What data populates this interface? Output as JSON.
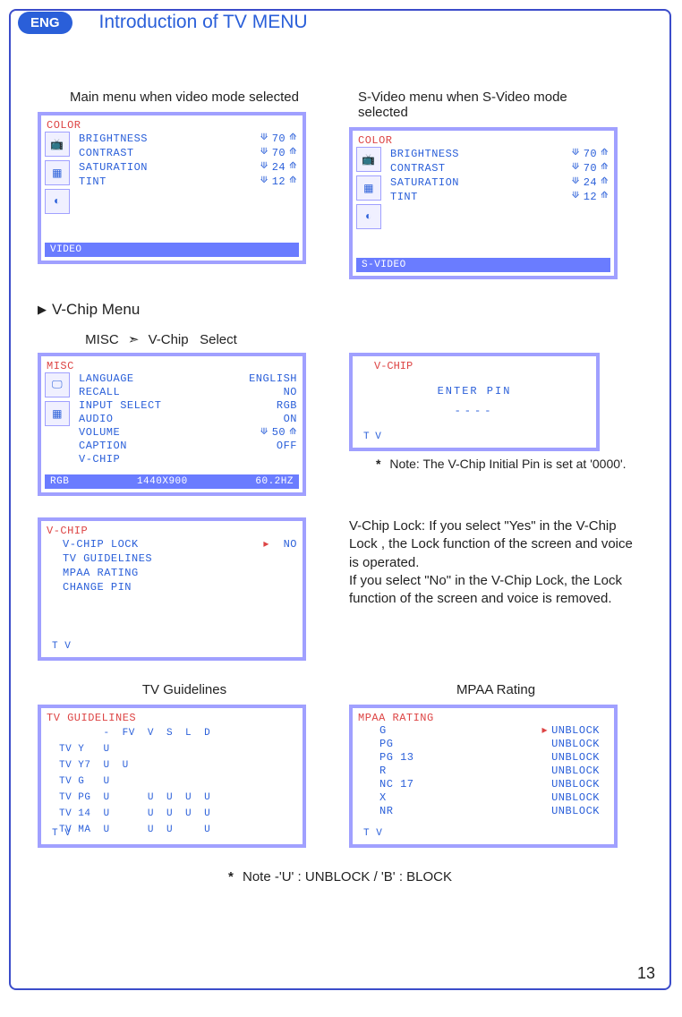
{
  "lang_badge": "ENG",
  "page_title": "Introduction of TV MENU",
  "captions": {
    "main_menu": "Main menu when video mode selected",
    "svideo_menu": "S-Video menu when S-Video mode selected",
    "tv_guidelines": "TV Guidelines",
    "mpaa_rating": "MPAA Rating"
  },
  "section_vchip": "V-Chip Menu",
  "path": {
    "a": "MISC",
    "arrow": "➣",
    "b": "V-Chip",
    "c": "Select"
  },
  "color_menu": {
    "header": "COLOR",
    "items": [
      {
        "label": "BRIGHTNESS",
        "val": "70"
      },
      {
        "label": "CONTRAST",
        "val": "70"
      },
      {
        "label": "SATURATION",
        "val": "24"
      },
      {
        "label": "TINT",
        "val": "12"
      }
    ],
    "footer_video": "VIDEO",
    "footer_svideo": "S-VIDEO"
  },
  "misc_menu": {
    "header": "MISC",
    "items": [
      {
        "label": "LANGUAGE",
        "val": "ENGLISH"
      },
      {
        "label": "RECALL",
        "val": "NO"
      },
      {
        "label": "INPUT SELECT",
        "val": "RGB"
      },
      {
        "label": "AUDIO",
        "val": "ON"
      },
      {
        "label": "VOLUME",
        "val": "50",
        "carets": true
      },
      {
        "label": "CAPTION",
        "val": "OFF"
      },
      {
        "label": "V-CHIP",
        "val": ""
      }
    ],
    "footer_left": "RGB",
    "footer_mid": "1440X900",
    "footer_right": "60.2HZ"
  },
  "vchip_pin": {
    "header": "V-CHIP",
    "enter": "ENTER  PIN",
    "dashes": "----",
    "footer": "T V"
  },
  "vchip_note_star": "*",
  "vchip_note": "Note: The V-Chip Initial Pin is set at '0000'.",
  "vchip_lock_menu": {
    "header": "V-CHIP",
    "items": [
      {
        "label": "V-CHIP  LOCK",
        "val": "NO",
        "mark": true
      },
      {
        "label": "TV  GUIDELINES",
        "val": ""
      },
      {
        "label": "MPAA  RATING",
        "val": ""
      },
      {
        "label": "CHANGE  PIN",
        "val": ""
      }
    ],
    "footer": "T V"
  },
  "vchip_lock_text1": "V-Chip Lock: If you select \"Yes\" in the V-Chip Lock , the Lock function of the screen and voice is operated.",
  "vchip_lock_text2": "If you select \"No\" in the V-Chip Lock, the Lock function of the screen and voice is removed.",
  "tv_guidelines_menu": {
    "header": "TV GUIDELINES",
    "cols": [
      "-",
      "FV",
      "V",
      "S",
      "L",
      "D"
    ],
    "rows": [
      {
        "name": "TV Y",
        "cells": [
          "U",
          "",
          "",
          "",
          "",
          ""
        ]
      },
      {
        "name": "TV Y7",
        "cells": [
          "U",
          "U",
          "",
          "",
          "",
          ""
        ]
      },
      {
        "name": "TV G",
        "cells": [
          "U",
          "",
          "",
          "",
          "",
          ""
        ]
      },
      {
        "name": "TV PG",
        "cells": [
          "U",
          "",
          "U",
          "U",
          "U",
          "U"
        ]
      },
      {
        "name": "TV 14",
        "cells": [
          "U",
          "",
          "U",
          "U",
          "U",
          "U"
        ]
      },
      {
        "name": "TV MA",
        "cells": [
          "U",
          "",
          "U",
          "U",
          "",
          "U"
        ]
      }
    ],
    "footer": "T V"
  },
  "mpaa_menu": {
    "header": "MPAA RATING",
    "items": [
      {
        "label": "G",
        "val": "UNBLOCK",
        "mark": true
      },
      {
        "label": "PG",
        "val": "UNBLOCK"
      },
      {
        "label": "PG 13",
        "val": "UNBLOCK"
      },
      {
        "label": "R",
        "val": "UNBLOCK"
      },
      {
        "label": "NC 17",
        "val": "UNBLOCK"
      },
      {
        "label": "X",
        "val": "UNBLOCK"
      },
      {
        "label": "NR",
        "val": "UNBLOCK"
      }
    ],
    "footer": "T V"
  },
  "footer_note_star": "*",
  "footer_note": "Note    -'U' : UNBLOCK  /  'B' : BLOCK",
  "page_number": "13"
}
